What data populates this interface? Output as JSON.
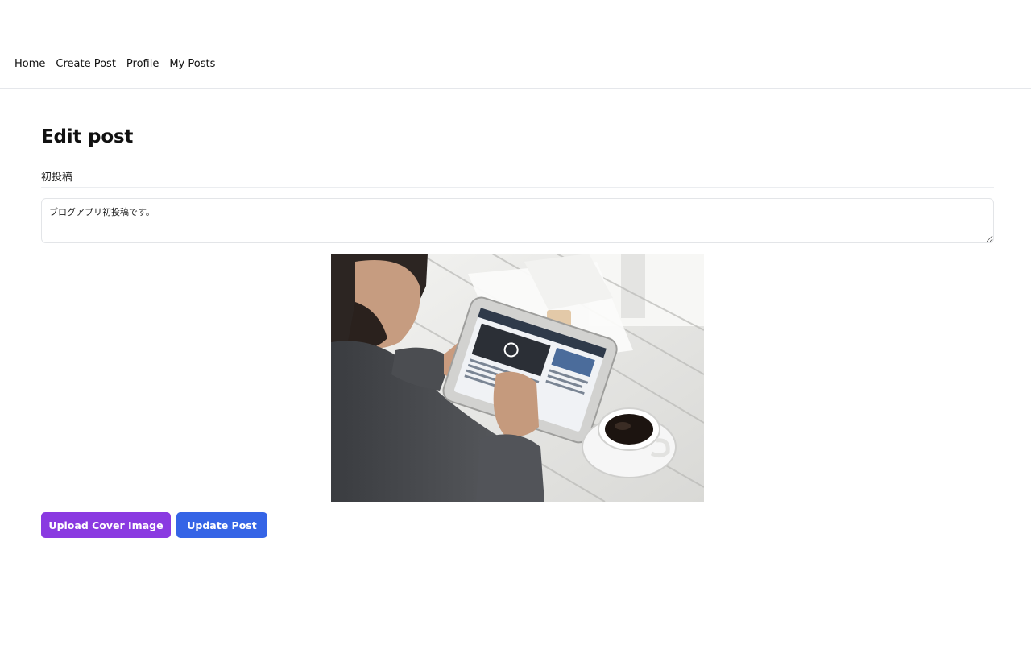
{
  "nav": {
    "items": [
      {
        "label": "Home"
      },
      {
        "label": "Create Post"
      },
      {
        "label": "Profile"
      },
      {
        "label": "My Posts"
      }
    ]
  },
  "page": {
    "title": "Edit post"
  },
  "form": {
    "title_value": "初投稿",
    "content_value": "ブログアプリ初投稿です。",
    "cover_image": {
      "description": "photo-cover",
      "colors": {
        "table": "#ecebe8",
        "sweater": "#4a4c50",
        "tablet_frame": "#cfcfcf",
        "coffee": "#1c1410"
      }
    }
  },
  "actions": {
    "upload_label": "Upload Cover Image",
    "update_label": "Update Post",
    "upload_color": "#8a3ae1",
    "update_color": "#3564e6"
  }
}
